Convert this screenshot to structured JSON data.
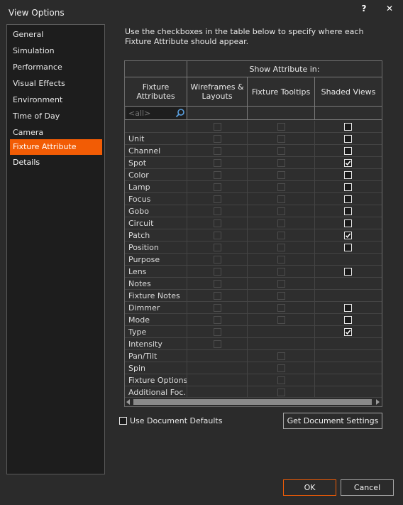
{
  "window": {
    "title": "View Options",
    "help_glyph": "?",
    "close_glyph": "✕"
  },
  "sidebar": {
    "items": [
      {
        "label": "General"
      },
      {
        "label": "Simulation"
      },
      {
        "label": "Performance"
      },
      {
        "label": "Visual Effects"
      },
      {
        "label": "Environment"
      },
      {
        "label": "Time of Day"
      },
      {
        "label": "Camera"
      },
      {
        "label": "Fixture Attribute Details",
        "selected": true
      }
    ]
  },
  "description": "Use the checkboxes in the table below to specify where each Fixture Attribute should appear.",
  "table": {
    "group_header": "Show Attribute in:",
    "columns": [
      "Fixture Attributes",
      "Wireframes & Layouts",
      "Fixture Tooltips",
      "Shaded Views"
    ],
    "filter_placeholder": "<all>",
    "select_all_row": {
      "wireframes": "disabled",
      "tooltips": "disabled",
      "shaded": "unchecked"
    },
    "rows": [
      {
        "name": "Unit",
        "wireframes": "disabled",
        "tooltips": "disabled",
        "shaded": "unchecked"
      },
      {
        "name": "Channel",
        "wireframes": "disabled",
        "tooltips": "disabled",
        "shaded": "unchecked"
      },
      {
        "name": "Spot",
        "wireframes": "disabled",
        "tooltips": "disabled",
        "shaded": "checked"
      },
      {
        "name": "Color",
        "wireframes": "disabled",
        "tooltips": "disabled",
        "shaded": "unchecked"
      },
      {
        "name": "Lamp",
        "wireframes": "disabled",
        "tooltips": "disabled",
        "shaded": "unchecked"
      },
      {
        "name": "Focus",
        "wireframes": "disabled",
        "tooltips": "disabled",
        "shaded": "unchecked"
      },
      {
        "name": "Gobo",
        "wireframes": "disabled",
        "tooltips": "disabled",
        "shaded": "unchecked"
      },
      {
        "name": "Circuit",
        "wireframes": "disabled",
        "tooltips": "disabled",
        "shaded": "unchecked"
      },
      {
        "name": "Patch",
        "wireframes": "disabled",
        "tooltips": "disabled",
        "shaded": "checked"
      },
      {
        "name": "Position",
        "wireframes": "disabled",
        "tooltips": "disabled",
        "shaded": "unchecked"
      },
      {
        "name": "Purpose",
        "wireframes": "disabled",
        "tooltips": "disabled",
        "shaded": "none"
      },
      {
        "name": "Lens",
        "wireframes": "disabled",
        "tooltips": "disabled",
        "shaded": "unchecked"
      },
      {
        "name": "Notes",
        "wireframes": "disabled",
        "tooltips": "disabled",
        "shaded": "none"
      },
      {
        "name": "Fixture Notes",
        "wireframes": "disabled",
        "tooltips": "disabled",
        "shaded": "none"
      },
      {
        "name": "Dimmer",
        "wireframes": "disabled",
        "tooltips": "disabled",
        "shaded": "unchecked"
      },
      {
        "name": "Mode",
        "wireframes": "disabled",
        "tooltips": "disabled",
        "shaded": "unchecked"
      },
      {
        "name": "Type",
        "wireframes": "disabled",
        "tooltips": "none",
        "shaded": "checked"
      },
      {
        "name": "Intensity",
        "wireframes": "disabled",
        "tooltips": "none",
        "shaded": "none"
      },
      {
        "name": "Pan/Tilt",
        "wireframes": "none",
        "tooltips": "disabled",
        "shaded": "none"
      },
      {
        "name": "Spin",
        "wireframes": "none",
        "tooltips": "disabled",
        "shaded": "none"
      },
      {
        "name": "Fixture Options",
        "wireframes": "none",
        "tooltips": "disabled",
        "shaded": "none"
      },
      {
        "name": "Additional Foc...",
        "wireframes": "none",
        "tooltips": "disabled",
        "shaded": "none"
      }
    ]
  },
  "use_document_defaults": {
    "label": "Use Document Defaults",
    "checked": false
  },
  "buttons": {
    "get_document_settings": "Get Document Settings",
    "ok": "OK",
    "cancel": "Cancel"
  },
  "colors": {
    "accent": "#f25c05",
    "background": "#2b2b2b",
    "panel": "#1d1d1d"
  }
}
